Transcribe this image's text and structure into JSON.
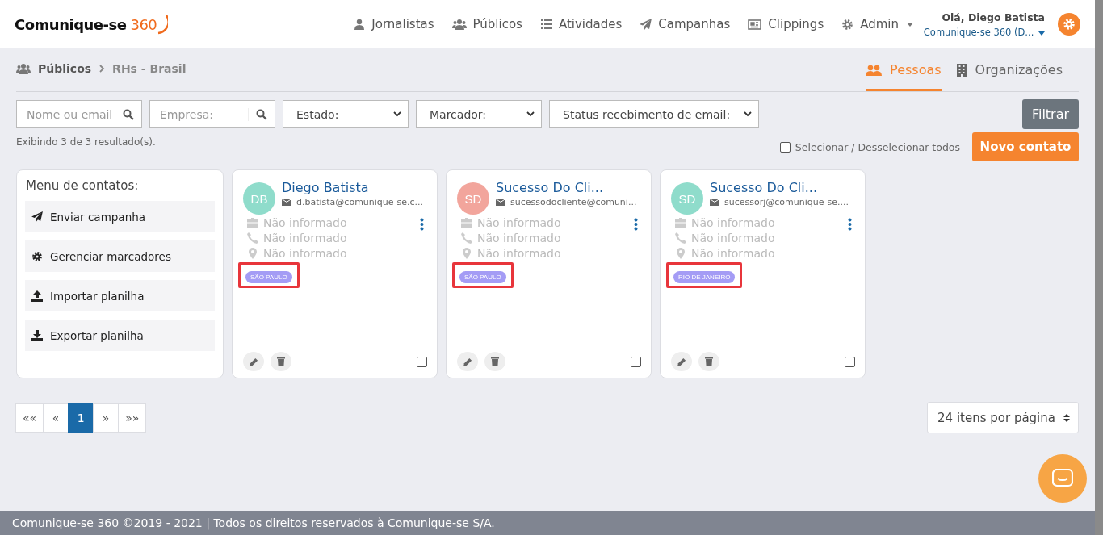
{
  "header": {
    "logo_text": "Comunique-se",
    "logo_number": "360",
    "nav": [
      {
        "kind": "journalists",
        "label": "Jornalistas"
      },
      {
        "kind": "audiences",
        "label": "Públicos"
      },
      {
        "kind": "activities",
        "label": "Atividades"
      },
      {
        "kind": "campaigns",
        "label": "Campanhas"
      },
      {
        "kind": "clippings",
        "label": "Clippings"
      },
      {
        "kind": "admin",
        "label": "Admin",
        "dropdown": true
      }
    ],
    "greeting": "Olá, Diego Batista",
    "account": "Comunique-se 360 (D..."
  },
  "breadcrumb": [
    "Públicos",
    "RHs - Brasil"
  ],
  "view_tabs": [
    {
      "kind": "people",
      "label": "Pessoas",
      "selected": true
    },
    {
      "kind": "orgs",
      "label": "Organizações",
      "selected": false
    }
  ],
  "filters": {
    "search_fields": [
      {
        "placeholder": "Nome ou email"
      },
      {
        "placeholder": "Empresa:"
      }
    ],
    "selects": [
      {
        "value": "Estado:"
      },
      {
        "value": "Marcador:"
      },
      {
        "value": "Status recebimento de email:"
      }
    ],
    "filter_button": "Filtrar"
  },
  "results_text": "Exibindo 3 de 3 resultado(s).",
  "select_all": {
    "label": "Selecionar / Desselecionar todos",
    "checked": false
  },
  "new_contact_button": "Novo contato",
  "contacts_menu": {
    "title": "Menu de contatos:",
    "items": [
      {
        "kind": "send",
        "label": "Enviar campanha"
      },
      {
        "kind": "tags",
        "label": "Gerenciar marcadores"
      },
      {
        "kind": "import",
        "label": "Importar planilha"
      },
      {
        "kind": "export",
        "label": "Exportar planilha"
      }
    ]
  },
  "contacts": [
    {
      "initials": "DB",
      "color": "#8fdccb",
      "name": "Diego Batista",
      "email": "d.batista@comunique-se.c...",
      "company": "Não informado",
      "phone": "Não informado",
      "location": "Não informado",
      "tag": "SÃO PAULO",
      "tag_highlighted": true,
      "checked": false
    },
    {
      "initials": "SD",
      "color": "#f2a59c",
      "name": "Sucesso Do Cli...",
      "email": "sucessodocliente@comuni...",
      "company": "Não informado",
      "phone": "Não informado",
      "location": "Não informado",
      "tag": "SÃO PAULO",
      "tag_highlighted": true,
      "checked": false
    },
    {
      "initials": "SD",
      "color": "#8fdccb",
      "name": "Sucesso Do Cli...",
      "email": "sucessorj@comunique-se....",
      "company": "Não informado",
      "phone": "Não informado",
      "location": "Não informado",
      "tag": "RIO DE JANEIRO",
      "tag_highlighted": true,
      "checked": false
    }
  ],
  "pagination": [
    {
      "label": "««",
      "selected": false
    },
    {
      "label": "«",
      "selected": false
    },
    {
      "label": "1",
      "selected": true
    },
    {
      "label": "»",
      "selected": false
    },
    {
      "label": "»»",
      "selected": false
    }
  ],
  "per_page": "24 itens por página",
  "footer": "Comunique-se 360 ©2019 - 2021 | Todos os direitos reservados à Comunique-se S/A."
}
